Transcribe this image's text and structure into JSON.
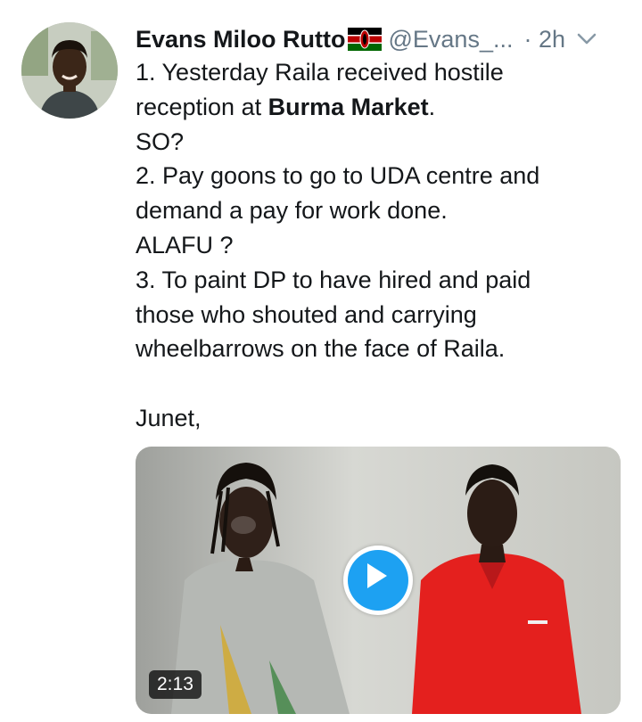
{
  "tweet": {
    "author_name": "Evans Miloo Rutto",
    "author_flag": "kenya-flag",
    "handle": "@Evans_...",
    "time": "· 2h",
    "menu_icon": "chevron-down-icon",
    "lines": [
      "1. Yesterday Raila received hostile",
      "reception at ",
      "SO?",
      "2. Pay goons to go to UDA centre and",
      "demand a pay for work done.",
      "ALAFU ?",
      "3. To paint  DP to have hired and paid",
      "those who shouted and carrying",
      "wheelbarrows on the face of Raila.",
      "Junet,"
    ],
    "bold_location": "Burma Market",
    "line2_suffix": ".",
    "media": {
      "type": "video",
      "duration": "2:13",
      "play_icon": "play-icon"
    }
  },
  "colors": {
    "text": "#14171a",
    "secondary": "#657786",
    "accent": "#1da1f2"
  }
}
